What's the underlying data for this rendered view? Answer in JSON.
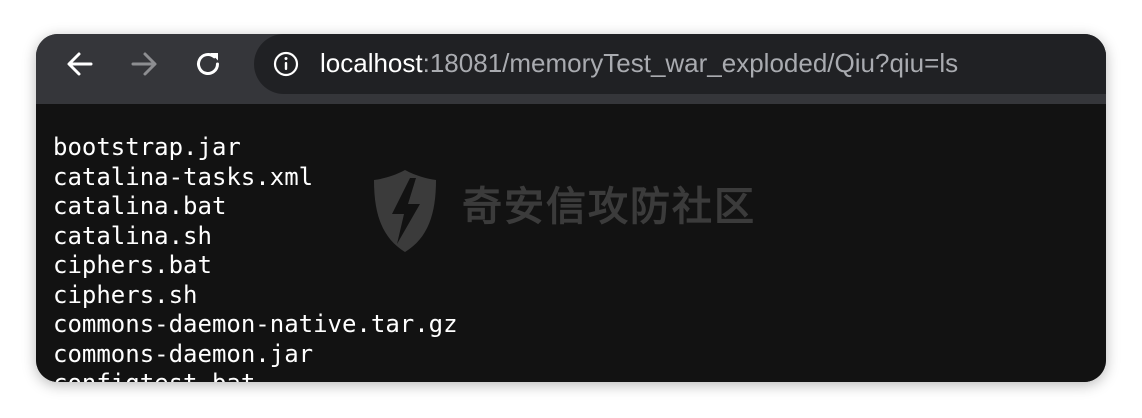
{
  "browser": {
    "back_icon": "arrow-left-icon",
    "forward_icon": "arrow-right-icon",
    "reload_icon": "reload-icon",
    "site_info_icon": "info-circle-icon",
    "url_host": "localhost",
    "url_rest": ":18081/memoryTest_war_exploded/Qiu?qiu=ls"
  },
  "page": {
    "files": [
      "bootstrap.jar",
      "catalina-tasks.xml",
      "catalina.bat",
      "catalina.sh",
      "ciphers.bat",
      "ciphers.sh",
      "commons-daemon-native.tar.gz",
      "commons-daemon.jar",
      "configtest.bat"
    ]
  },
  "watermark": {
    "text": "奇安信攻防社区",
    "logo": "lightning-shield-logo"
  },
  "colors": {
    "toolbar_bg": "#35363a",
    "omnibox_bg": "#202124",
    "page_bg": "#121212",
    "text": "#ffffff",
    "url_path": "#a9abb0"
  }
}
